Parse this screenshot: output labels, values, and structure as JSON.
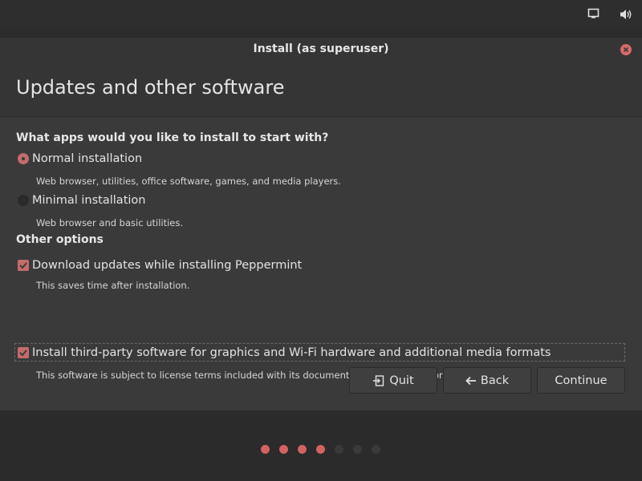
{
  "window": {
    "title": "Install (as superuser)"
  },
  "page": {
    "title": "Updates and other software"
  },
  "question": "What apps would you like to install to start with?",
  "installation_options": [
    {
      "label": "Normal installation",
      "description": "Web browser, utilities, office software, games, and media players.",
      "selected": true
    },
    {
      "label": "Minimal installation",
      "description": "Web browser and basic utilities.",
      "selected": false
    }
  ],
  "other_options": {
    "heading": "Other options",
    "items": [
      {
        "label": "Download updates while installing Peppermint",
        "description": "This saves time after installation.",
        "checked": true
      },
      {
        "label": "Install third-party software for graphics and Wi-Fi hardware and additional media formats",
        "description": "This software is subject to license terms included with its documentation. Some is proprietary.",
        "checked": true
      }
    ]
  },
  "buttons": {
    "quit": "Quit",
    "back": "Back",
    "continue": "Continue"
  },
  "progress": {
    "total_steps": 7,
    "completed_steps": 4
  },
  "colors": {
    "accent": "#c46b6b",
    "dot_done": "#d36262"
  },
  "tray_icons": [
    "display-icon",
    "volume-icon"
  ]
}
